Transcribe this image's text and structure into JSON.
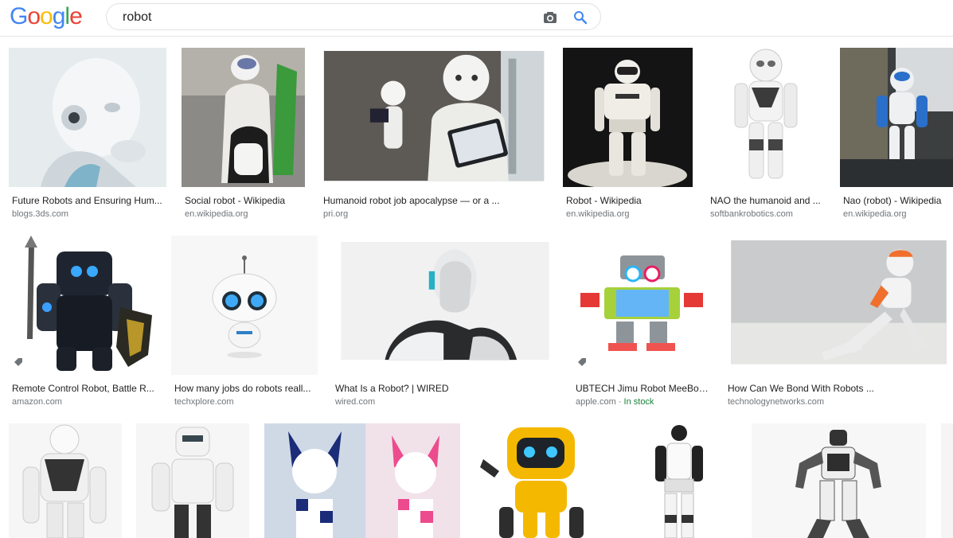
{
  "logo": {
    "letters": [
      "G",
      "o",
      "o",
      "g",
      "l",
      "e"
    ],
    "colors": [
      "#4285F4",
      "#EA4335",
      "#FBBC05",
      "#4285F4",
      "#34A853",
      "#EA4335"
    ]
  },
  "search": {
    "value": "robot",
    "camera_icon": "camera-icon",
    "search_icon": "search-icon"
  },
  "results": [
    {
      "title": "Future Robots and Ensuring Hum...",
      "source": "blogs.3ds.com"
    },
    {
      "title": "Social robot - Wikipedia",
      "source": "en.wikipedia.org"
    },
    {
      "title": "Humanoid robot job apocalypse — or a ...",
      "source": "pri.org"
    },
    {
      "title": "Robot - Wikipedia",
      "source": "en.wikipedia.org"
    },
    {
      "title": "NAO the humanoid and ...",
      "source": "softbankrobotics.com"
    },
    {
      "title": "Nao (robot) - Wikipedia",
      "source": "en.wikipedia.org"
    },
    {
      "title": "Remote Control Robot, Battle R...",
      "source": "amazon.com"
    },
    {
      "title": "How many jobs do robots reall...",
      "source": "techxplore.com"
    },
    {
      "title": "What Is a Robot? | WIRED",
      "source": "wired.com"
    },
    {
      "title": "UBTECH Jimu Robot MeeBot...",
      "source": "apple.com · ",
      "stock": "In stock"
    },
    {
      "title": "How Can We Bond With Robots ...",
      "source": "technologynetworks.com"
    }
  ]
}
